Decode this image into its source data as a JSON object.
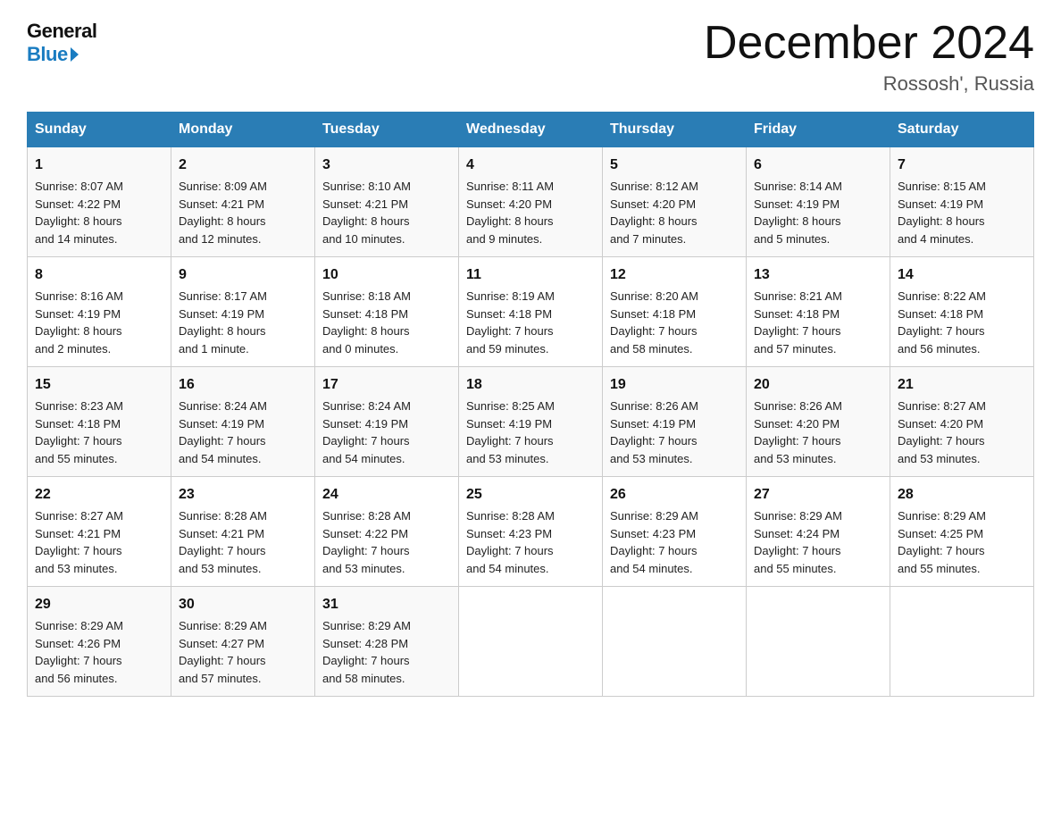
{
  "header": {
    "logo_line1": "General",
    "logo_line2": "Blue",
    "month_title": "December 2024",
    "location": "Rossosh', Russia"
  },
  "weekdays": [
    "Sunday",
    "Monday",
    "Tuesday",
    "Wednesday",
    "Thursday",
    "Friday",
    "Saturday"
  ],
  "weeks": [
    [
      {
        "day": "1",
        "info": "Sunrise: 8:07 AM\nSunset: 4:22 PM\nDaylight: 8 hours\nand 14 minutes."
      },
      {
        "day": "2",
        "info": "Sunrise: 8:09 AM\nSunset: 4:21 PM\nDaylight: 8 hours\nand 12 minutes."
      },
      {
        "day": "3",
        "info": "Sunrise: 8:10 AM\nSunset: 4:21 PM\nDaylight: 8 hours\nand 10 minutes."
      },
      {
        "day": "4",
        "info": "Sunrise: 8:11 AM\nSunset: 4:20 PM\nDaylight: 8 hours\nand 9 minutes."
      },
      {
        "day": "5",
        "info": "Sunrise: 8:12 AM\nSunset: 4:20 PM\nDaylight: 8 hours\nand 7 minutes."
      },
      {
        "day": "6",
        "info": "Sunrise: 8:14 AM\nSunset: 4:19 PM\nDaylight: 8 hours\nand 5 minutes."
      },
      {
        "day": "7",
        "info": "Sunrise: 8:15 AM\nSunset: 4:19 PM\nDaylight: 8 hours\nand 4 minutes."
      }
    ],
    [
      {
        "day": "8",
        "info": "Sunrise: 8:16 AM\nSunset: 4:19 PM\nDaylight: 8 hours\nand 2 minutes."
      },
      {
        "day": "9",
        "info": "Sunrise: 8:17 AM\nSunset: 4:19 PM\nDaylight: 8 hours\nand 1 minute."
      },
      {
        "day": "10",
        "info": "Sunrise: 8:18 AM\nSunset: 4:18 PM\nDaylight: 8 hours\nand 0 minutes."
      },
      {
        "day": "11",
        "info": "Sunrise: 8:19 AM\nSunset: 4:18 PM\nDaylight: 7 hours\nand 59 minutes."
      },
      {
        "day": "12",
        "info": "Sunrise: 8:20 AM\nSunset: 4:18 PM\nDaylight: 7 hours\nand 58 minutes."
      },
      {
        "day": "13",
        "info": "Sunrise: 8:21 AM\nSunset: 4:18 PM\nDaylight: 7 hours\nand 57 minutes."
      },
      {
        "day": "14",
        "info": "Sunrise: 8:22 AM\nSunset: 4:18 PM\nDaylight: 7 hours\nand 56 minutes."
      }
    ],
    [
      {
        "day": "15",
        "info": "Sunrise: 8:23 AM\nSunset: 4:18 PM\nDaylight: 7 hours\nand 55 minutes."
      },
      {
        "day": "16",
        "info": "Sunrise: 8:24 AM\nSunset: 4:19 PM\nDaylight: 7 hours\nand 54 minutes."
      },
      {
        "day": "17",
        "info": "Sunrise: 8:24 AM\nSunset: 4:19 PM\nDaylight: 7 hours\nand 54 minutes."
      },
      {
        "day": "18",
        "info": "Sunrise: 8:25 AM\nSunset: 4:19 PM\nDaylight: 7 hours\nand 53 minutes."
      },
      {
        "day": "19",
        "info": "Sunrise: 8:26 AM\nSunset: 4:19 PM\nDaylight: 7 hours\nand 53 minutes."
      },
      {
        "day": "20",
        "info": "Sunrise: 8:26 AM\nSunset: 4:20 PM\nDaylight: 7 hours\nand 53 minutes."
      },
      {
        "day": "21",
        "info": "Sunrise: 8:27 AM\nSunset: 4:20 PM\nDaylight: 7 hours\nand 53 minutes."
      }
    ],
    [
      {
        "day": "22",
        "info": "Sunrise: 8:27 AM\nSunset: 4:21 PM\nDaylight: 7 hours\nand 53 minutes."
      },
      {
        "day": "23",
        "info": "Sunrise: 8:28 AM\nSunset: 4:21 PM\nDaylight: 7 hours\nand 53 minutes."
      },
      {
        "day": "24",
        "info": "Sunrise: 8:28 AM\nSunset: 4:22 PM\nDaylight: 7 hours\nand 53 minutes."
      },
      {
        "day": "25",
        "info": "Sunrise: 8:28 AM\nSunset: 4:23 PM\nDaylight: 7 hours\nand 54 minutes."
      },
      {
        "day": "26",
        "info": "Sunrise: 8:29 AM\nSunset: 4:23 PM\nDaylight: 7 hours\nand 54 minutes."
      },
      {
        "day": "27",
        "info": "Sunrise: 8:29 AM\nSunset: 4:24 PM\nDaylight: 7 hours\nand 55 minutes."
      },
      {
        "day": "28",
        "info": "Sunrise: 8:29 AM\nSunset: 4:25 PM\nDaylight: 7 hours\nand 55 minutes."
      }
    ],
    [
      {
        "day": "29",
        "info": "Sunrise: 8:29 AM\nSunset: 4:26 PM\nDaylight: 7 hours\nand 56 minutes."
      },
      {
        "day": "30",
        "info": "Sunrise: 8:29 AM\nSunset: 4:27 PM\nDaylight: 7 hours\nand 57 minutes."
      },
      {
        "day": "31",
        "info": "Sunrise: 8:29 AM\nSunset: 4:28 PM\nDaylight: 7 hours\nand 58 minutes."
      },
      {
        "day": "",
        "info": ""
      },
      {
        "day": "",
        "info": ""
      },
      {
        "day": "",
        "info": ""
      },
      {
        "day": "",
        "info": ""
      }
    ]
  ]
}
